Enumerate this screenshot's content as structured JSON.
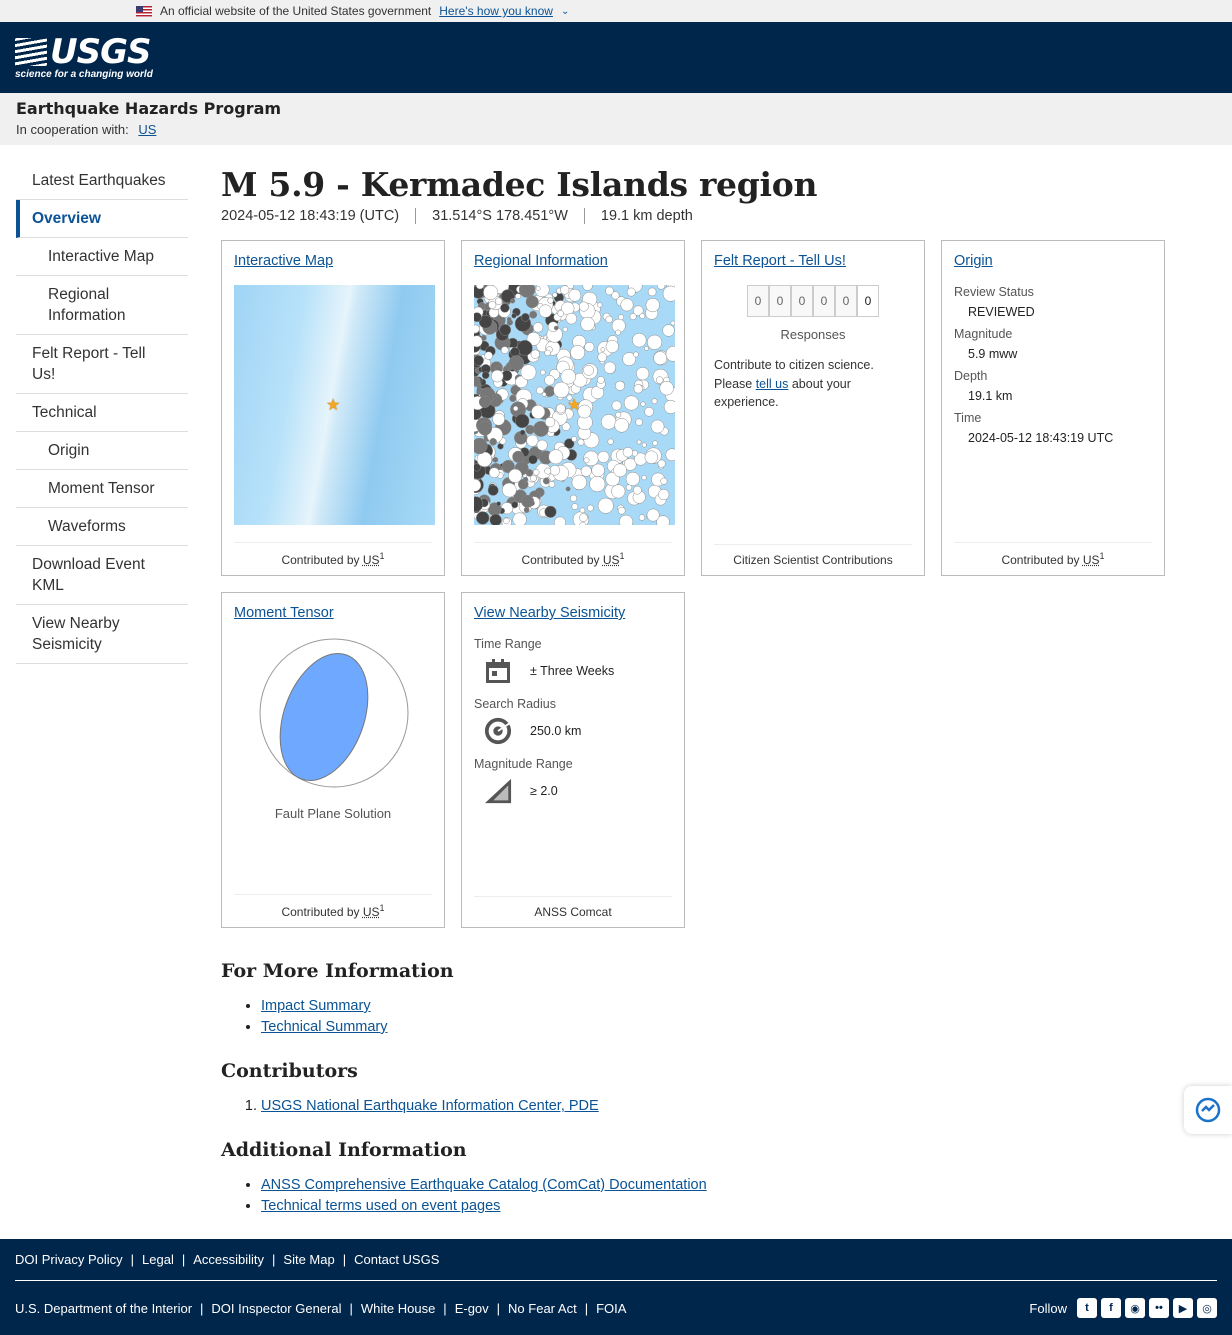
{
  "govbar": {
    "text": "An official website of the United States government",
    "how_link": "Here's how you know"
  },
  "header": {
    "logo_text": "USGS",
    "logo_tagline": "science for a changing world"
  },
  "program": {
    "title": "Earthquake Hazards Program",
    "coop_label": "In cooperation with:",
    "coop_link": "US"
  },
  "sidebar": {
    "items": [
      {
        "label": "Latest Earthquakes"
      },
      {
        "label": "Overview"
      },
      {
        "label": "Interactive Map"
      },
      {
        "label": "Regional Information"
      },
      {
        "label": "Felt Report - Tell Us!"
      },
      {
        "label": "Technical"
      },
      {
        "label": "Origin"
      },
      {
        "label": "Moment Tensor"
      },
      {
        "label": "Waveforms"
      },
      {
        "label": "Download Event KML"
      },
      {
        "label": "View Nearby Seismicity"
      }
    ]
  },
  "event": {
    "title": "M 5.9 - Kermadec Islands region",
    "time": "2024-05-12 18:43:19 (UTC)",
    "coords": "31.514°S 178.451°W",
    "depth": "19.1 km depth"
  },
  "cards": {
    "interactive_map": {
      "title": "Interactive Map",
      "foot": "Contributed by",
      "contrib": "US",
      "sup": "1"
    },
    "regional": {
      "title": "Regional Information",
      "foot": "Contributed by",
      "contrib": "US",
      "sup": "1"
    },
    "felt": {
      "title": "Felt Report - Tell Us!",
      "digits": [
        "0",
        "0",
        "0",
        "0",
        "0",
        "0"
      ],
      "responses_label": "Responses",
      "text_before": "Contribute to citizen science. Please ",
      "link": "tell us",
      "text_after": " about your experience.",
      "foot": "Citizen Scientist Contributions"
    },
    "origin": {
      "title": "Origin",
      "review_label": "Review Status",
      "review_value": "REVIEWED",
      "mag_label": "Magnitude",
      "mag_value": "5.9 mww",
      "depth_label": "Depth",
      "depth_value": "19.1 km",
      "time_label": "Time",
      "time_value": "2024-05-12 18:43:19 UTC",
      "foot": "Contributed by",
      "contrib": "US",
      "sup": "1"
    },
    "moment_tensor": {
      "title": "Moment Tensor",
      "caption": "Fault Plane Solution",
      "foot": "Contributed by",
      "contrib": "US",
      "sup": "1"
    },
    "nearby": {
      "title": "View Nearby Seismicity",
      "time_label": "Time Range",
      "time_value": "± Three Weeks",
      "radius_label": "Search Radius",
      "radius_value": "250.0 km",
      "mag_label": "Magnitude Range",
      "mag_value": "≥ 2.0",
      "foot": "ANSS Comcat"
    }
  },
  "more_info": {
    "heading": "For More Information",
    "links": [
      "Impact Summary",
      "Technical Summary"
    ]
  },
  "contributors": {
    "heading": "Contributors",
    "links": [
      "USGS National Earthquake Information Center, PDE"
    ]
  },
  "additional": {
    "heading": "Additional Information",
    "links": [
      "ANSS Comprehensive Earthquake Catalog (ComCat) Documentation",
      "Technical terms used on event pages"
    ]
  },
  "footer": {
    "row1": [
      "DOI Privacy Policy",
      "Legal",
      "Accessibility",
      "Site Map",
      "Contact USGS"
    ],
    "row2": [
      "U.S. Department of the Interior",
      "DOI Inspector General",
      "White House",
      "E-gov",
      "No Fear Act",
      "FOIA"
    ],
    "follow": "Follow"
  },
  "colors": {
    "navy": "#00264c",
    "link": "#0b5394",
    "star": "#f5a623",
    "beachball": "#6fa8ff"
  },
  "icons": [
    "calendar-icon",
    "radius-icon",
    "magnitude-icon",
    "twitter-icon",
    "facebook-icon",
    "github-icon",
    "flickr-icon",
    "youtube-icon",
    "instagram-icon"
  ]
}
